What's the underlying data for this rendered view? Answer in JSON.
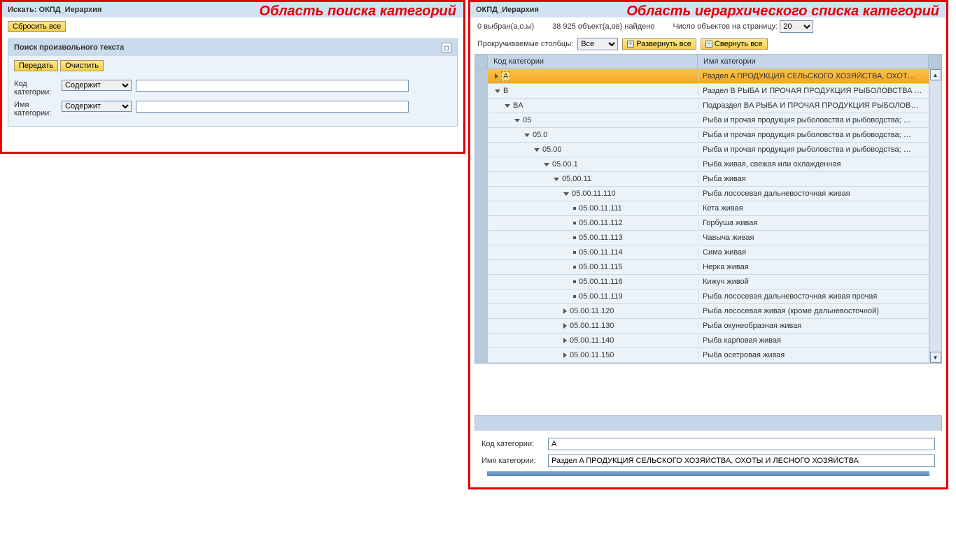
{
  "left": {
    "title": "Искать: ОКПД_Иерархия",
    "overlay": "Область поиска категорий",
    "reset_all": "Сбросить все",
    "search_group": {
      "title": "Поиск произвольного текста",
      "submit": "Передать",
      "clear": "Очистить",
      "code_label": "Код категории:",
      "name_label": "Имя категории:",
      "op_contains": "Содержит"
    }
  },
  "right": {
    "title": "ОКПД_Иерархия",
    "overlay": "Область иерархического списка категорий",
    "selected": "0 выбран(а,о,ы)",
    "found": "38 925 объект(а,ов) найдено",
    "per_page_label": "Число объектов на страницу:",
    "per_page_value": "20",
    "scroll_cols_label": "Прокручиваемые столбцы:",
    "scroll_cols_value": "Все",
    "expand_all": "Развернуть все",
    "collapse_all": "Свернуть все",
    "col_code": "Код категории",
    "col_name": "Имя категории",
    "detail_code_label": "Код категории:",
    "detail_code_value": "A",
    "detail_name_label": "Имя категории:",
    "detail_name_value": "Раздел A ПРОДУКЦИЯ СЕЛЬСКОГО ХОЗЯЙСТВА, ОХОТЫ И ЛЕСНОГО ХОЗЯЙСТВА",
    "rows": [
      {
        "indent": 0,
        "expander": "right",
        "code": "A",
        "name": "Раздел A ПРОДУКЦИЯ СЕЛЬСКОГО ХОЗЯЙСТВА, ОХОТ…",
        "selected": true
      },
      {
        "indent": 0,
        "expander": "down",
        "code": "B",
        "name": "Раздел B РЫБА И ПРОЧАЯ ПРОДУКЦИЯ РЫБОЛОВСТВА …"
      },
      {
        "indent": 1,
        "expander": "down",
        "code": "BA",
        "name": "Подраздел BA РЫБА И ПРОЧАЯ ПРОДУКЦИЯ РЫБОЛОВ…"
      },
      {
        "indent": 2,
        "expander": "down",
        "code": "05",
        "name": "Рыба и прочая продукция рыболовства и рыбоводства; …"
      },
      {
        "indent": 3,
        "expander": "down",
        "code": "05.0",
        "name": "Рыба и прочая продукция рыболовства и рыбоводства; …"
      },
      {
        "indent": 4,
        "expander": "down",
        "code": "05.00",
        "name": "Рыба и прочая продукция рыболовства и рыбоводства; …"
      },
      {
        "indent": 5,
        "expander": "down",
        "code": "05.00.1",
        "name": "Рыба живая, свежая или охлажденная"
      },
      {
        "indent": 6,
        "expander": "down",
        "code": "05.00.11",
        "name": "Рыба живая"
      },
      {
        "indent": 7,
        "expander": "down",
        "code": "05.00.11.110",
        "name": "Рыба лососевая дальневосточная живая"
      },
      {
        "indent": 8,
        "expander": "leaf",
        "code": "05.00.11.111",
        "name": "Кета живая"
      },
      {
        "indent": 8,
        "expander": "leaf",
        "code": "05.00.11.112",
        "name": "Горбуша живая"
      },
      {
        "indent": 8,
        "expander": "leaf",
        "code": "05.00.11.113",
        "name": "Чавыча живая"
      },
      {
        "indent": 8,
        "expander": "leaf",
        "code": "05.00.11.114",
        "name": "Сима живая"
      },
      {
        "indent": 8,
        "expander": "leaf",
        "code": "05.00.11.115",
        "name": "Нерка живая"
      },
      {
        "indent": 8,
        "expander": "leaf",
        "code": "05.00.11.116",
        "name": "Кижуч живой"
      },
      {
        "indent": 8,
        "expander": "leaf",
        "code": "05.00.11.119",
        "name": "Рыба лососевая дальневосточная живая прочая"
      },
      {
        "indent": 7,
        "expander": "right",
        "code": "05.00.11.120",
        "name": "Рыба лососевая живая (кроме дальневосточной)"
      },
      {
        "indent": 7,
        "expander": "right",
        "code": "05.00.11.130",
        "name": "Рыба окунеобразная живая"
      },
      {
        "indent": 7,
        "expander": "right",
        "code": "05.00.11.140",
        "name": "Рыба карповая живая"
      },
      {
        "indent": 7,
        "expander": "right",
        "code": "05.00.11.150",
        "name": "Рыба осетровая живая"
      }
    ]
  }
}
